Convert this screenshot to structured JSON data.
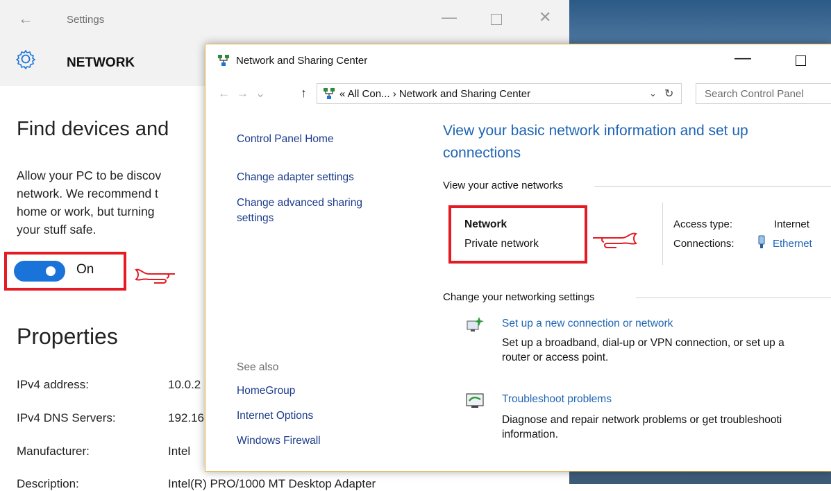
{
  "settings": {
    "title": "Settings",
    "section": "NETWORK",
    "find_heading": "Find devices and",
    "find_desc": [
      "Allow your PC to be discov",
      "network. We recommend t",
      "home or work, but turning",
      "your stuff safe."
    ],
    "toggle_label": "On",
    "toggle_state": "on",
    "properties_heading": "Properties",
    "properties": [
      {
        "label": "IPv4 address:",
        "value": "10.0.2"
      },
      {
        "label": "IPv4 DNS Servers:",
        "value": "192.16"
      },
      {
        "label": "Manufacturer:",
        "value": "Intel"
      },
      {
        "label": "Description:",
        "value": "Intel(R) PRO/1000 MT Desktop Adapter"
      }
    ]
  },
  "nsc": {
    "title": "Network and Sharing Center",
    "address": "« All Con...  ›  Network and Sharing Center",
    "search_placeholder": "Search Control Panel",
    "left_links": {
      "home": "Control Panel Home",
      "adapter": "Change adapter settings",
      "advanced_1": "Change advanced sharing",
      "advanced_2": "settings"
    },
    "see_also_label": "See also",
    "see_also": [
      "HomeGroup",
      "Internet Options",
      "Windows Firewall"
    ],
    "main_heading_1": "View your basic network information and set up",
    "main_heading_2": "connections",
    "active_networks_label": "View your active networks",
    "network": {
      "name": "Network",
      "type": "Private network",
      "access_label": "Access type:",
      "access_value": "Internet",
      "connections_label": "Connections:",
      "connections_value": "Ethernet"
    },
    "change_settings_label": "Change your networking settings",
    "tasks": [
      {
        "link": "Set up a new connection or network",
        "desc_1": "Set up a broadband, dial-up or VPN connection, or set up a",
        "desc_2": "router or access point."
      },
      {
        "link": "Troubleshoot problems",
        "desc_1": "Diagnose and repair network problems or get troubleshooti",
        "desc_2": "information."
      }
    ]
  },
  "colors": {
    "accent_blue": "#1e64b4",
    "link_blue": "#1a3a8a",
    "toggle_blue": "#1a73d8",
    "highlight_red": "#e51b23",
    "window_border": "#f0b429"
  }
}
